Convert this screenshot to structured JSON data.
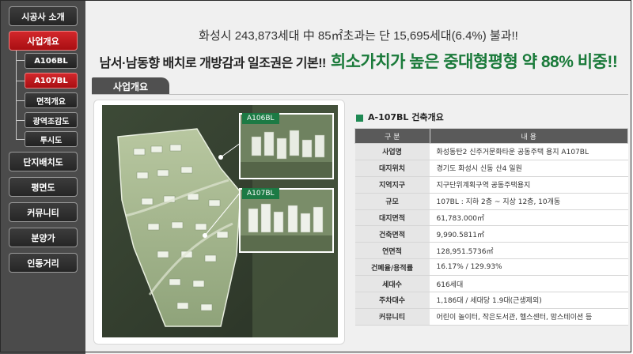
{
  "sidebar": {
    "items": [
      {
        "label": "시공사 소개"
      },
      {
        "label": "사업개요"
      },
      {
        "label": "단지배치도"
      },
      {
        "label": "평면도"
      },
      {
        "label": "커뮤니티"
      },
      {
        "label": "분양가"
      },
      {
        "label": "인동거리"
      }
    ],
    "sub_items": [
      {
        "label": "A106BL"
      },
      {
        "label": "A107BL"
      },
      {
        "label": "면적개요"
      },
      {
        "label": "광역조감도"
      },
      {
        "label": "투시도"
      }
    ]
  },
  "headline": {
    "line1": "화성시 243,873세대 中 85㎡초과는 단 15,695세대(6.4%) 불과!!",
    "line2_a": "남서·남동향 배치로 개방감과 일조권은 기본!!",
    "line2_b": "희소가치가 높은 중대형평형 약 88% 비중!!"
  },
  "section_title": "사업개요",
  "map": {
    "label_a106": "A106BL",
    "label_a107": "A107BL"
  },
  "table": {
    "title": "A-107BL 건축개요",
    "header_col1": "구 분",
    "header_col2": "내 용",
    "rows": [
      {
        "key": "사업명",
        "value": "화성동탄2 신주거문화타운 공동주택 용지 A107BL"
      },
      {
        "key": "대지위치",
        "value": "경기도 화성시 신동 산4 일원"
      },
      {
        "key": "지역지구",
        "value": "지구단위계획구역 공동주택용지"
      },
      {
        "key": "규모",
        "value": "107BL : 지하 2층 ~ 지상 12층, 10개동"
      },
      {
        "key": "대지면적",
        "value": "61,783.000㎡"
      },
      {
        "key": "건축면적",
        "value": "9,990.5811㎡"
      },
      {
        "key": "연면적",
        "value": "128,951.5736㎡"
      },
      {
        "key": "건폐율/용적률",
        "value": "16.17% / 129.93%"
      },
      {
        "key": "세대수",
        "value": "616세대"
      },
      {
        "key": "주차대수",
        "value": "1,186대 / 세대당 1.9대(근생제외)"
      },
      {
        "key": "커뮤니티",
        "value": "어린이 놀이터, 작은도서관, 헬스센터, 맘스테이션 등"
      }
    ]
  },
  "colors": {
    "active_red": "#c41a1e",
    "accent_green": "#1a7a3a",
    "sidebar_bg": "#4b4b4b"
  }
}
